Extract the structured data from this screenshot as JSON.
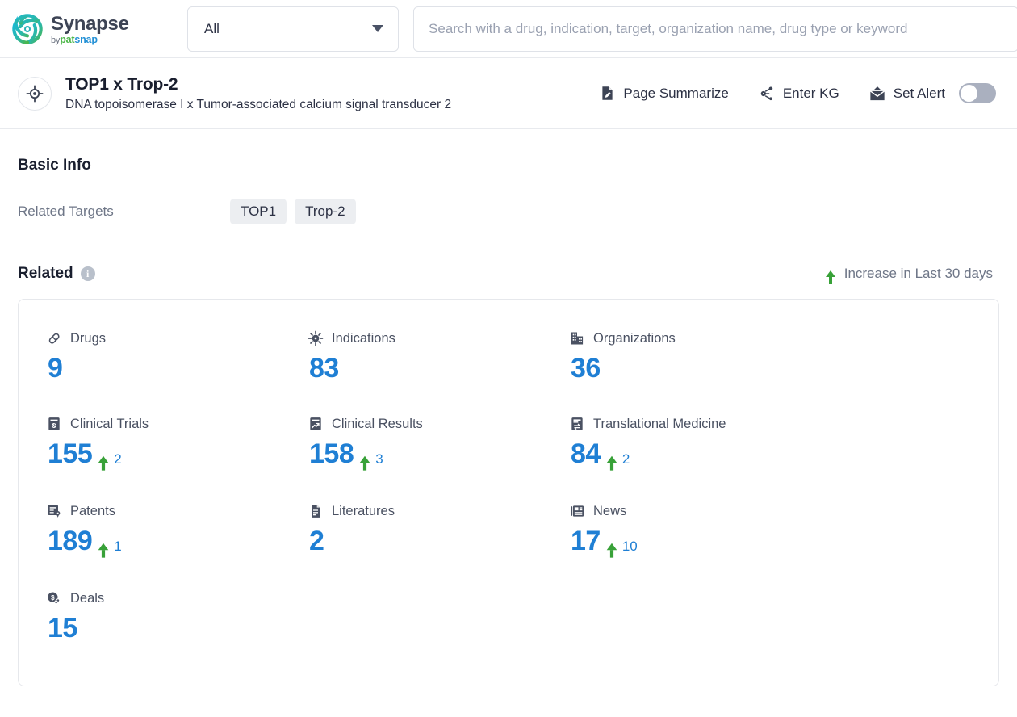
{
  "brand": {
    "name": "Synapse",
    "by": "by",
    "pat": "pat",
    "snap": "snap",
    "logo_icon": "synapse-swirl-logo"
  },
  "search": {
    "scope_value": "All",
    "placeholder": "Search with a drug, indication, target, organization name, drug type or keyword",
    "value": "",
    "caret_icon": "chevron-down-icon"
  },
  "entity": {
    "icon": "target-crosshair-icon",
    "title": "TOP1 x Trop-2",
    "subtitle": "DNA topoisomerase I x Tumor-associated calcium signal transducer 2",
    "actions": [
      {
        "label": "Page Summarize",
        "icon": "document-pen-icon"
      },
      {
        "label": "Enter KG",
        "icon": "knowledge-graph-icon"
      },
      {
        "label": "Set Alert",
        "icon": "alert-envelope-icon",
        "toggle": "off"
      }
    ]
  },
  "basic_info": {
    "heading": "Basic Info",
    "related_targets_label": "Related Targets",
    "related_targets": [
      "TOP1",
      "Trop-2"
    ]
  },
  "related": {
    "heading": "Related",
    "info_icon": "info-icon",
    "info_glyph": "i",
    "legend_text": "Increase in Last 30 days",
    "legend_icon": "arrow-up-icon",
    "accent_blue": "#1f7fd4",
    "increase_green": "#38a138",
    "metrics": [
      {
        "label": "Drugs",
        "icon": "pill-capsule-icon",
        "value": "9",
        "delta": ""
      },
      {
        "label": "Indications",
        "icon": "virus-icon",
        "value": "83",
        "delta": ""
      },
      {
        "label": "Organizations",
        "icon": "building-icon",
        "value": "36",
        "delta": ""
      },
      {
        "label": "Clinical Trials",
        "icon": "clinical-trial-doc-icon",
        "value": "155",
        "delta": "2"
      },
      {
        "label": "Clinical Results",
        "icon": "clinical-result-chart-icon",
        "value": "158",
        "delta": "3"
      },
      {
        "label": "Translational Medicine",
        "icon": "translational-medicine-icon",
        "value": "84",
        "delta": "2"
      },
      {
        "label": "Patents",
        "icon": "patent-certificate-icon",
        "value": "189",
        "delta": "1"
      },
      {
        "label": "Literatures",
        "icon": "literature-doc-icon",
        "value": "2",
        "delta": ""
      },
      {
        "label": "News",
        "icon": "news-paper-icon",
        "value": "17",
        "delta": "10"
      },
      {
        "label": "Deals",
        "icon": "deal-coin-pill-icon",
        "value": "15",
        "delta": ""
      }
    ]
  }
}
